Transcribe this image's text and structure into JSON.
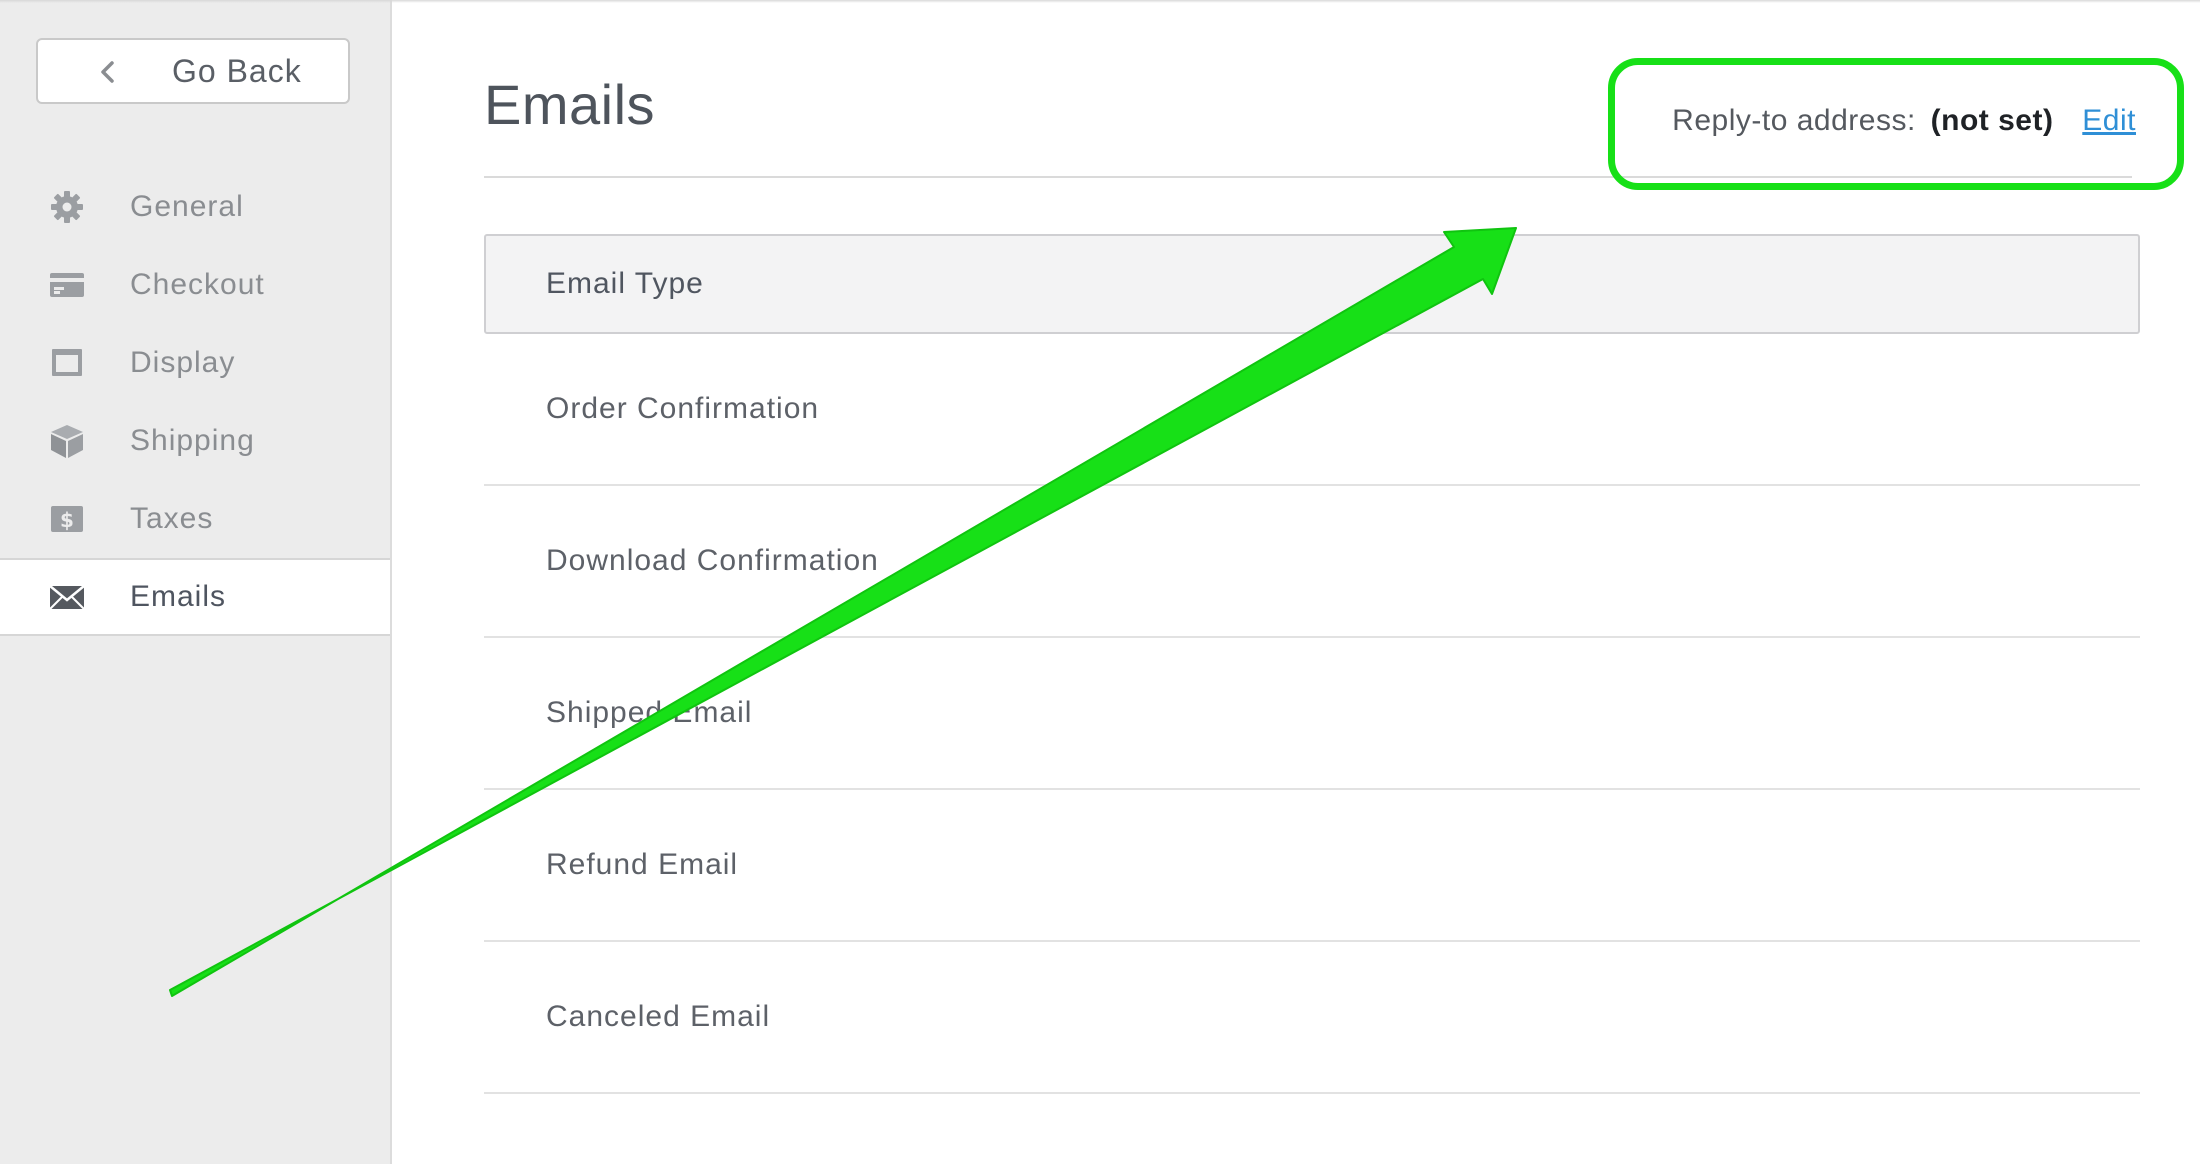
{
  "sidebar": {
    "back_label": "Go Back",
    "items": [
      {
        "label": "General",
        "icon": "gear-icon"
      },
      {
        "label": "Checkout",
        "icon": "credit-card-icon"
      },
      {
        "label": "Display",
        "icon": "window-icon"
      },
      {
        "label": "Shipping",
        "icon": "box-icon"
      },
      {
        "label": "Taxes",
        "icon": "dollar-icon"
      },
      {
        "label": "Emails",
        "icon": "envelope-icon",
        "active": true
      }
    ]
  },
  "main": {
    "title": "Emails",
    "reply_to": {
      "label": "Reply-to address:",
      "value": "(not set)",
      "edit_label": "Edit"
    },
    "table": {
      "header": "Email Type",
      "rows": [
        "Order Confirmation",
        "Download Confirmation",
        "Shipped Email",
        "Refund Email",
        "Canceled Email"
      ]
    }
  },
  "colors": {
    "annotation": "#17e017",
    "link": "#2f8fd6",
    "sidebar_bg": "#ececec"
  }
}
